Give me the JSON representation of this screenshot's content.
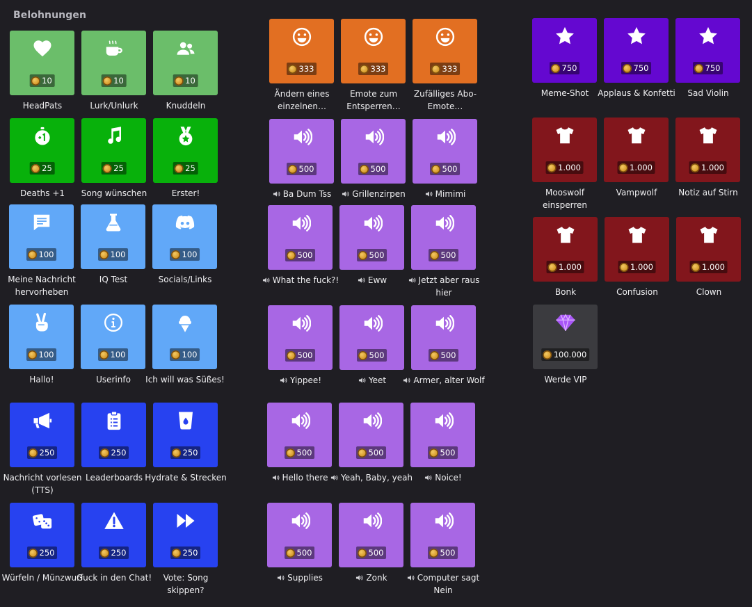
{
  "section_title": "Belohnungen",
  "rewards": [
    {
      "id": "headpats",
      "label": "HeadPats",
      "cost": "10",
      "color": "lgreen",
      "icon": "heart-icon",
      "sound": false
    },
    {
      "id": "lurk",
      "label": "Lurk/Unlurk",
      "cost": "10",
      "color": "lgreen",
      "icon": "coffee-cup-icon",
      "sound": false
    },
    {
      "id": "knuddeln",
      "label": "Knuddeln",
      "cost": "10",
      "color": "lgreen",
      "icon": "users-icon",
      "sound": false
    },
    {
      "id": "deaths",
      "label": "Deaths +1",
      "cost": "25",
      "color": "green",
      "icon": "stopwatch-plus-one-icon",
      "sound": false
    },
    {
      "id": "song",
      "label": "Song wünschen",
      "cost": "25",
      "color": "green",
      "icon": "music-note-icon",
      "sound": false
    },
    {
      "id": "erster",
      "label": "Erster!",
      "cost": "25",
      "color": "green",
      "icon": "medal-icon",
      "sound": false
    },
    {
      "id": "highlight",
      "label": "Meine Nachricht hervorheben",
      "cost": "100",
      "color": "lblue",
      "icon": "message-icon",
      "sound": false
    },
    {
      "id": "iqtest",
      "label": "IQ Test",
      "cost": "100",
      "color": "lblue",
      "icon": "flask-icon",
      "sound": false
    },
    {
      "id": "socials",
      "label": "Socials/Links",
      "cost": "100",
      "color": "lblue",
      "icon": "discord-icon",
      "sound": false
    },
    {
      "id": "hallo",
      "label": "Hallo!",
      "cost": "100",
      "color": "lblue",
      "icon": "peace-hand-icon",
      "sound": false
    },
    {
      "id": "userinfo",
      "label": "Userinfo",
      "cost": "100",
      "color": "lblue",
      "icon": "info-icon",
      "sound": false
    },
    {
      "id": "suesses",
      "label": "Ich will was Süßes!",
      "cost": "100",
      "color": "lblue",
      "icon": "ice-cream-icon",
      "sound": false
    },
    {
      "id": "tts",
      "label": "Nachricht vorlesen (TTS)",
      "cost": "250",
      "color": "blue",
      "icon": "megaphone-icon",
      "sound": false
    },
    {
      "id": "leaderboards",
      "label": "Leaderboards",
      "cost": "250",
      "color": "blue",
      "icon": "clipboard-list-icon",
      "sound": false
    },
    {
      "id": "hydrate",
      "label": "Hydrate & Strecken",
      "cost": "250",
      "color": "blue",
      "icon": "water-glass-icon",
      "sound": false
    },
    {
      "id": "wuerfeln",
      "label": "Würfeln / Münzwurf",
      "cost": "250",
      "color": "blue",
      "icon": "dice-icon",
      "sound": false
    },
    {
      "id": "guck",
      "label": "Guck in den Chat!",
      "cost": "250",
      "color": "blue",
      "icon": "warning-icon",
      "sound": false
    },
    {
      "id": "voteskip",
      "label": "Vote: Song skippen?",
      "cost": "250",
      "color": "blue",
      "icon": "fast-forward-icon",
      "sound": false
    },
    {
      "id": "emote-aendern",
      "label": "Ändern eines einzelnen…",
      "cost": "333",
      "color": "orange",
      "icon": "smile-icon",
      "sound": false
    },
    {
      "id": "emote-entsperren",
      "label": "Emote zum Entsperren…",
      "cost": "333",
      "color": "orange",
      "icon": "smile-icon",
      "sound": false
    },
    {
      "id": "emote-zufall",
      "label": "Zufälliges Abo-Emote…",
      "cost": "333",
      "color": "orange",
      "icon": "smile-icon",
      "sound": false
    },
    {
      "id": "badumtss",
      "label": "Ba Dum Tss",
      "cost": "500",
      "color": "lilac",
      "icon": "volume-icon",
      "sound": true
    },
    {
      "id": "grillen",
      "label": "Grillenzirpen",
      "cost": "500",
      "color": "lilac",
      "icon": "volume-icon",
      "sound": true
    },
    {
      "id": "mimimi",
      "label": "Mimimi",
      "cost": "500",
      "color": "lilac",
      "icon": "volume-icon",
      "sound": true
    },
    {
      "id": "wtf",
      "label": "What the fuck?!",
      "cost": "500",
      "color": "lilac",
      "icon": "volume-icon",
      "sound": true
    },
    {
      "id": "eww",
      "label": "Eww",
      "cost": "500",
      "color": "lilac",
      "icon": "volume-icon",
      "sound": true
    },
    {
      "id": "rausHier",
      "label": "Jetzt aber raus hier",
      "cost": "500",
      "color": "lilac",
      "icon": "volume-icon",
      "sound": true
    },
    {
      "id": "yippee",
      "label": "Yippee!",
      "cost": "500",
      "color": "lilac",
      "icon": "volume-icon",
      "sound": true
    },
    {
      "id": "yeet",
      "label": "Yeet",
      "cost": "500",
      "color": "lilac",
      "icon": "volume-icon",
      "sound": true
    },
    {
      "id": "armerwolf",
      "label": "Armer, alter Wolf",
      "cost": "500",
      "color": "lilac",
      "icon": "volume-icon",
      "sound": true
    },
    {
      "id": "hellothere",
      "label": "Hello there",
      "cost": "500",
      "color": "lilac",
      "icon": "volume-icon",
      "sound": true
    },
    {
      "id": "yeahbaby",
      "label": "Yeah, Baby, yeah",
      "cost": "500",
      "color": "lilac",
      "icon": "volume-icon",
      "sound": true
    },
    {
      "id": "noice",
      "label": "Noice!",
      "cost": "500",
      "color": "lilac",
      "icon": "volume-icon",
      "sound": true
    },
    {
      "id": "supplies",
      "label": "Supplies",
      "cost": "500",
      "color": "lilac",
      "icon": "volume-icon",
      "sound": true
    },
    {
      "id": "zonk",
      "label": "Zonk",
      "cost": "500",
      "color": "lilac",
      "icon": "volume-icon",
      "sound": true
    },
    {
      "id": "computernein",
      "label": "Computer sagt Nein",
      "cost": "500",
      "color": "lilac",
      "icon": "volume-icon",
      "sound": true
    },
    {
      "id": "memeshot",
      "label": "Meme-Shot",
      "cost": "750",
      "color": "purple",
      "icon": "star-icon",
      "sound": false
    },
    {
      "id": "applaus",
      "label": "Applaus & Konfetti",
      "cost": "750",
      "color": "purple",
      "icon": "star-icon",
      "sound": false
    },
    {
      "id": "sadviolin",
      "label": "Sad Violin",
      "cost": "750",
      "color": "purple",
      "icon": "star-icon",
      "sound": false
    },
    {
      "id": "mooswolf",
      "label": "Mooswolf einsperren",
      "cost": "1.000",
      "color": "red",
      "icon": "tshirt-icon",
      "sound": false
    },
    {
      "id": "vampwolf",
      "label": "Vampwolf",
      "cost": "1.000",
      "color": "red",
      "icon": "tshirt-icon",
      "sound": false
    },
    {
      "id": "notiz",
      "label": "Notiz auf Stirn",
      "cost": "1.000",
      "color": "red",
      "icon": "tshirt-icon",
      "sound": false
    },
    {
      "id": "bonk",
      "label": "Bonk",
      "cost": "1.000",
      "color": "red",
      "icon": "tshirt-icon",
      "sound": false
    },
    {
      "id": "confusion",
      "label": "Confusion",
      "cost": "1.000",
      "color": "red",
      "icon": "tshirt-icon",
      "sound": false
    },
    {
      "id": "clown",
      "label": "Clown",
      "cost": "1.000",
      "color": "red",
      "icon": "tshirt-icon",
      "sound": false
    },
    {
      "id": "vip",
      "label": "Werde VIP",
      "cost": "100.000",
      "color": "dark",
      "icon": "diamond-icon",
      "sound": false
    }
  ]
}
